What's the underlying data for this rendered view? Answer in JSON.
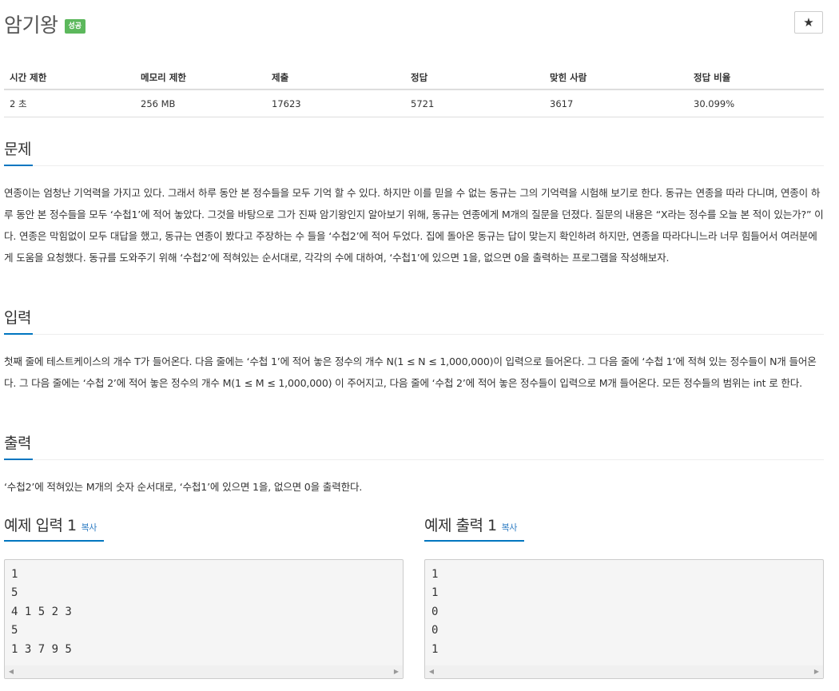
{
  "problem": {
    "title": "암기왕",
    "badge": "성공",
    "star_icon": "★"
  },
  "info_table": {
    "headers": [
      "시간 제한",
      "메모리 제한",
      "제출",
      "정답",
      "맞힌 사람",
      "정답 비율"
    ],
    "values": [
      "2 초",
      "256 MB",
      "17623",
      "5721",
      "3617",
      "30.099%"
    ]
  },
  "sections": {
    "description": {
      "heading": "문제",
      "text": "연종이는 엄청난 기억력을 가지고 있다. 그래서 하루 동안 본 정수들을 모두 기억 할 수 있다. 하지만 이를 믿을 수 없는 동규는 그의 기억력을 시험해 보기로 한다. 동규는 연종을 따라 다니며, 연종이 하루 동안 본 정수들을 모두 ‘수첩1’에 적어 놓았다. 그것을 바탕으로 그가 진짜 암기왕인지 알아보기 위해, 동규는 연종에게 M개의 질문을 던졌다. 질문의 내용은 “X라는 정수를 오늘 본 적이 있는가?” 이다. 연종은 막힘없이 모두 대답을 했고, 동규는 연종이 봤다고 주장하는 수 들을 ‘수첩2’에 적어 두었다. 집에 돌아온 동규는 답이 맞는지 확인하려 하지만, 연종을 따라다니느라 너무 힘들어서 여러분에게 도움을 요청했다. 동규를 도와주기 위해 ‘수첩2’에 적혀있는 순서대로, 각각의 수에 대하여, ‘수첩1’에 있으면 1을, 없으면 0을 출력하는 프로그램을 작성해보자."
    },
    "input": {
      "heading": "입력",
      "text": "첫째 줄에 테스트케이스의 개수 T가 들어온다. 다음 줄에는 ‘수첩 1’에 적어 놓은 정수의 개수 N(1 ≤ N ≤ 1,000,000)이 입력으로 들어온다. 그 다음 줄에  ‘수첩 1’에 적혀 있는 정수들이 N개 들어온다. 그 다음 줄에는 ‘수첩 2’에 적어 놓은 정수의 개수 M(1 ≤ M ≤ 1,000,000) 이 주어지고, 다음 줄에 ‘수첩 2’에 적어 놓은 정수들이 입력으로 M개 들어온다. 모든 정수들의 범위는 int 로 한다."
    },
    "output": {
      "heading": "출력",
      "text": "‘수첩2’에 적혀있는 M개의 숫자 순서대로, ‘수첩1’에 있으면 1을, 없으면 0을 출력한다."
    }
  },
  "samples": {
    "copy_label": "복사",
    "input": {
      "heading": "예제 입력 1",
      "content": "1\n5\n4 1 5 2 3\n5\n1 3 7 9 5"
    },
    "output": {
      "heading": "예제 출력 1",
      "content": "1\n1\n0\n0\n1"
    }
  },
  "colors": {
    "badge_success": "#5cb85c",
    "accent_underline": "#0076c0",
    "copy_link": "#2f7dc4"
  }
}
